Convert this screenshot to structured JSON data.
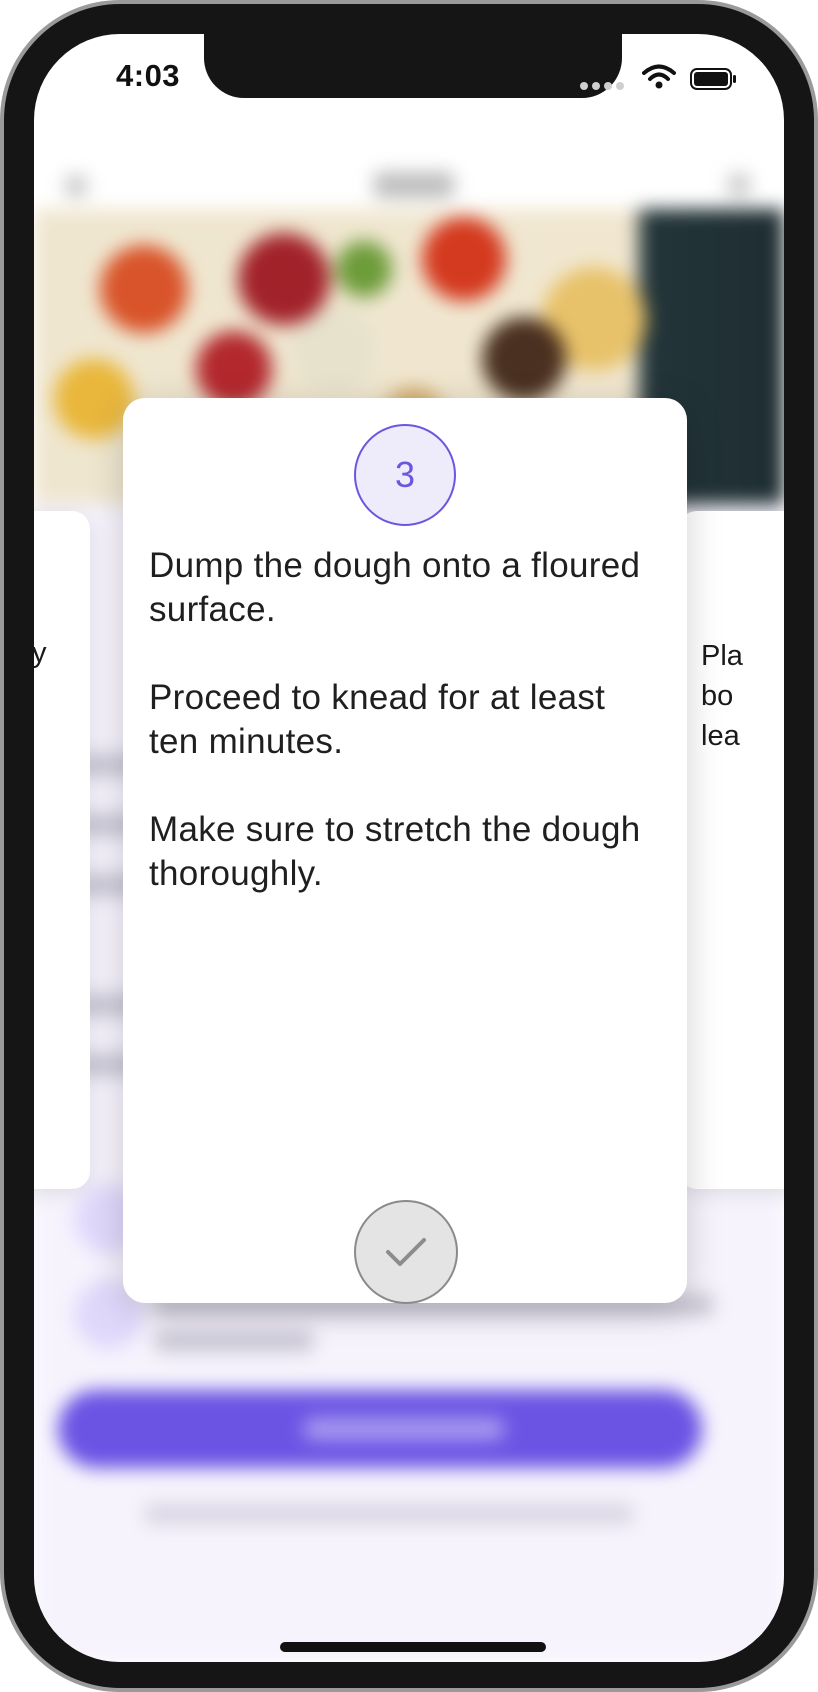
{
  "status_bar": {
    "time": "4:03"
  },
  "step_card": {
    "step_number": "3",
    "paragraphs": [
      "Dump the dough onto a floured surface.",
      "Proceed to knead for at least ten minutes.",
      "Make sure to stretch the dough thoroughly."
    ],
    "done_icon": "checkmark-icon"
  },
  "side_cards": {
    "left_text": "y",
    "right_text": "Pla\nbo\nlea"
  },
  "colors": {
    "accent": "#6a56e0",
    "done_button_bg": "#e4e4e4"
  }
}
